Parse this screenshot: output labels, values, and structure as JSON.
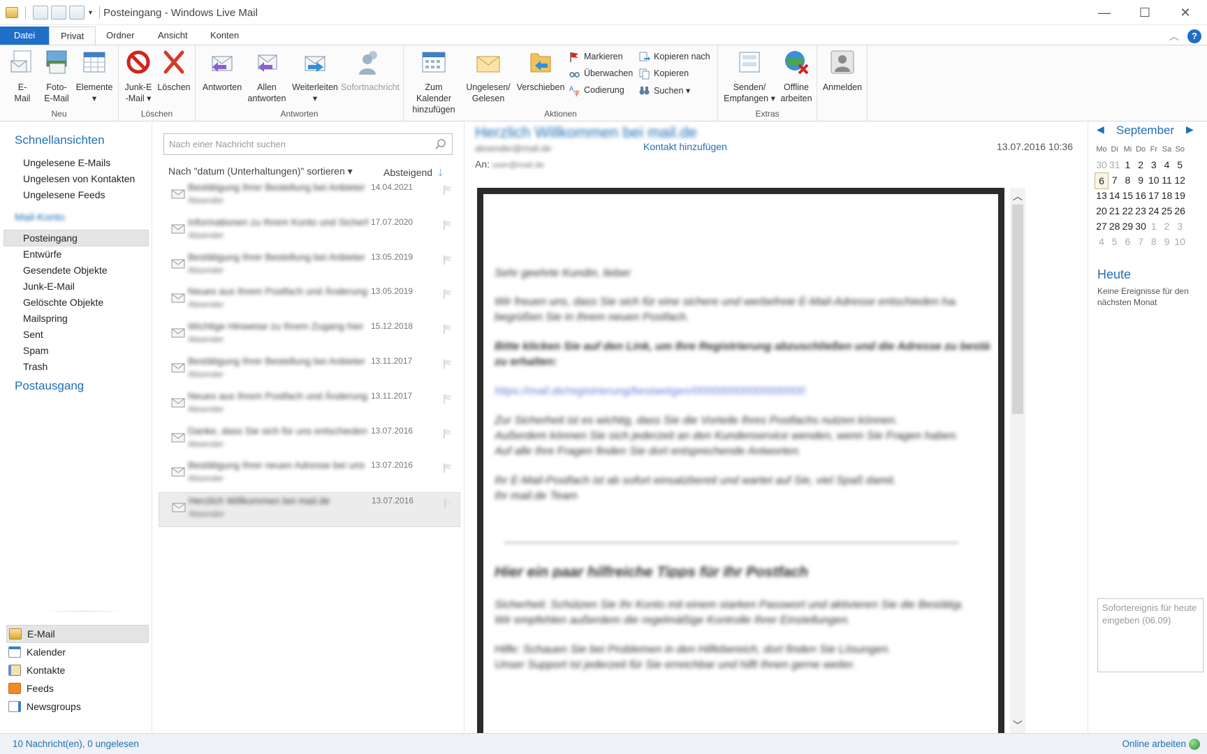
{
  "window": {
    "title": "Posteingang - Windows Live Mail"
  },
  "tabs": [
    {
      "label": "Datei"
    },
    {
      "label": "Privat"
    },
    {
      "label": "Ordner"
    },
    {
      "label": "Ansicht"
    },
    {
      "label": "Konten"
    }
  ],
  "ribbon": {
    "groups": {
      "neu": "Neu",
      "loeschen": "Löschen",
      "antworten": "Antworten",
      "aktionen": "Aktionen",
      "extras": "Extras"
    },
    "buttons": {
      "email": [
        "E-",
        "Mail"
      ],
      "foto": [
        "Foto-",
        "E-Mail"
      ],
      "elemente": [
        "Elemente",
        "▾"
      ],
      "junk": [
        "Junk-E",
        "-Mail ▾"
      ],
      "loeschen": [
        "Löschen",
        ""
      ],
      "antworten": [
        "Antworten",
        ""
      ],
      "allen": [
        "Allen",
        "antworten"
      ],
      "weiterleiten": [
        "Weiterleiten",
        "▾"
      ],
      "sofort": [
        "Sofortnachricht",
        ""
      ],
      "kalender": [
        "Zum Kalender",
        "hinzufügen"
      ],
      "ungelesen": [
        "Ungelesen/",
        "Gelesen"
      ],
      "verschieben": [
        "Verschieben",
        ""
      ],
      "senden": [
        "Senden/",
        "Empfangen ▾"
      ],
      "offline": [
        "Offline",
        "arbeiten"
      ],
      "anmelden": [
        "Anmelden",
        ""
      ]
    },
    "small": {
      "markieren": "Markieren",
      "ueberwachen": "Überwachen",
      "codierung": "Codierung",
      "kopieren_nach": "Kopieren nach",
      "kopieren": "Kopieren",
      "suchen": "Suchen ▾"
    }
  },
  "nav": {
    "quick_title": "Schnellansichten",
    "quick_items": [
      "Ungelesene E-Mails",
      "Ungelesen von Kontakten",
      "Ungelesene Feeds"
    ],
    "account_blurred": "Mail-Konto",
    "folders": [
      "Posteingang",
      "Entwürfe",
      "Gesendete Objekte",
      "Junk-E-Mail",
      "Gelöschte Objekte",
      "Mailspring",
      "Sent",
      "Spam",
      "Trash"
    ],
    "outbox": "Postausgang",
    "bottom": [
      "E-Mail",
      "Kalender",
      "Kontakte",
      "Feeds",
      "Newsgroups"
    ]
  },
  "list": {
    "search_placeholder": "Nach einer Nachricht suchen",
    "sort_label": "Nach \"datum (Unterhaltungen)\" sortieren ▾",
    "sort_dir": "Absteigend",
    "messages": [
      {
        "date": "14.04.2021"
      },
      {
        "date": "17.07.2020"
      },
      {
        "date": "13.05.2019"
      },
      {
        "date": "13.05.2019"
      },
      {
        "date": "15.12.2018"
      },
      {
        "date": "13.11.2017"
      },
      {
        "date": "13.11.2017"
      },
      {
        "date": "13.07.2016"
      },
      {
        "date": "13.07.2016"
      },
      {
        "date": "13.07.2016"
      }
    ]
  },
  "reader": {
    "contact_link": "Kontakt hinzufügen",
    "date": "13.07.2016 10:36",
    "to_label": "An:"
  },
  "calendar": {
    "month": "September",
    "dow": [
      "Mo",
      "Di",
      "Mi",
      "Do",
      "Fr",
      "Sa",
      "So"
    ],
    "weeks": [
      [
        "30",
        "31",
        "1",
        "2",
        "3",
        "4",
        "5"
      ],
      [
        "6",
        "7",
        "8",
        "9",
        "10",
        "11",
        "12"
      ],
      [
        "13",
        "14",
        "15",
        "16",
        "17",
        "18",
        "19"
      ],
      [
        "20",
        "21",
        "22",
        "23",
        "24",
        "25",
        "26"
      ],
      [
        "27",
        "28",
        "29",
        "30",
        "1",
        "2",
        "3"
      ],
      [
        "4",
        "5",
        "6",
        "7",
        "8",
        "9",
        "10"
      ]
    ],
    "today_title": "Heute",
    "today_text": "Keine Ereignisse für den nächsten Monat",
    "quick_event_placeholder": "Sofortereignis für heute eingeben (06.09)"
  },
  "status": {
    "left": "10 Nachricht(en), 0 ungelesen",
    "right": "Online arbeiten"
  },
  "colors": {
    "accent": "#1e6fc8",
    "link": "#1f6fb5"
  }
}
